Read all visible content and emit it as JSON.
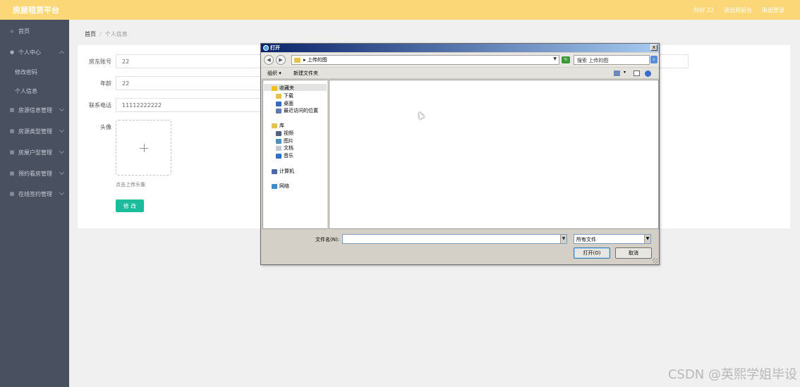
{
  "app": {
    "brand": "房屋租赁平台",
    "top_links": [
      "你好 22",
      "退出到前台",
      "退出登录"
    ]
  },
  "sidebar": {
    "items": [
      {
        "label": "首页",
        "icon": "home-icon"
      },
      {
        "label": "个人中心",
        "icon": "user-icon",
        "subs": [
          "修改密码",
          "个人信息"
        ]
      },
      {
        "label": "房源信息管理",
        "icon": "grid-icon"
      },
      {
        "label": "房源类型管理",
        "icon": "grid-icon"
      },
      {
        "label": "房屋户型管理",
        "icon": "grid-icon"
      },
      {
        "label": "预约看房管理",
        "icon": "grid-icon"
      },
      {
        "label": "在线签约管理",
        "icon": "grid-icon"
      }
    ]
  },
  "breadcrumb": {
    "home": "首页",
    "sep": "/",
    "current": "个人信息"
  },
  "form": {
    "account_label": "房东账号",
    "account_value": "22",
    "age_label": "年龄",
    "age_value": "22",
    "phone_label": "联系电话",
    "phone_value": "11112222222",
    "avatar_label": "头像",
    "upload_hint": "点击上传头像",
    "submit_label": "修 改"
  },
  "dialog": {
    "title": "打开",
    "close": "x",
    "address_path": "▸ 上传的图",
    "search_placeholder": "搜索 上传的图",
    "commands": {
      "organize": "组织 ▾",
      "new_folder": "新建文件夹"
    },
    "tree": [
      {
        "label": "收藏夹",
        "icon": "star-icon",
        "color": "#f0c020"
      },
      {
        "label": "下载",
        "icon": "download-icon",
        "color": "#e8c050"
      },
      {
        "label": "桌面",
        "icon": "desktop-icon",
        "color": "#3a6ab8"
      },
      {
        "label": "最近访问的位置",
        "icon": "recent-icon",
        "color": "#5a7ab0"
      },
      {
        "label": "库",
        "icon": "library-icon",
        "color": "#e8c050"
      },
      {
        "label": "视频",
        "icon": "video-icon",
        "color": "#506080"
      },
      {
        "label": "图片",
        "icon": "picture-icon",
        "color": "#4a90c0"
      },
      {
        "label": "文档",
        "icon": "document-icon",
        "color": "#c0c8d8"
      },
      {
        "label": "音乐",
        "icon": "music-icon",
        "color": "#3070c0"
      },
      {
        "label": "计算机",
        "icon": "computer-icon",
        "color": "#4a6aa8"
      },
      {
        "label": "网络",
        "icon": "network-icon",
        "color": "#3a8ad0"
      }
    ],
    "filename_label": "文件名(N):",
    "filename_value": "",
    "filetype_value": "所有文件",
    "open_label": "打开(O)",
    "cancel_label": "取消"
  },
  "watermark": "CSDN @英熙学姐毕设"
}
